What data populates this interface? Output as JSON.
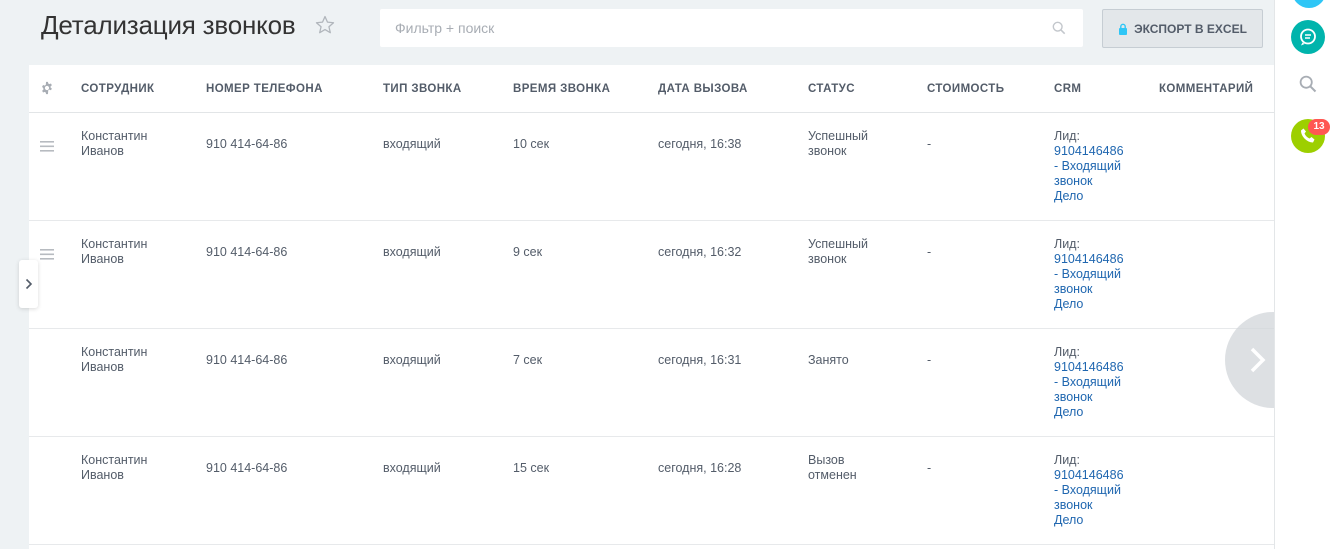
{
  "page": {
    "title": "Детализация звонков"
  },
  "search": {
    "placeholder": "Фильтр + поиск",
    "value": ""
  },
  "toolbar": {
    "export_label": "ЭКСПОРТ В EXCEL"
  },
  "table": {
    "columns": [
      "СОТРУДНИК",
      "НОМЕР ТЕЛЕФОНА",
      "ТИП ЗВОНКА",
      "ВРЕМЯ ЗВОНКА",
      "ДАТА ВЫЗОВА",
      "СТАТУС",
      "СТОИМОСТЬ",
      "CRM",
      "КОММЕНТАРИЙ"
    ],
    "rows": [
      {
        "employee_line1": "Константин",
        "employee_line2": "Иванов",
        "phone": "910 414-64-86",
        "type": "входящий",
        "duration": "10 сек",
        "date": "сегодня, 16:38",
        "status_line1": "Успешный",
        "status_line2": "звонок",
        "cost": "-",
        "crm_prefix": "Лид:",
        "crm_link1": "9104146486",
        "crm_link2": "- Входящий",
        "crm_link3": "звонок",
        "crm_link4": "Дело",
        "comment": ""
      },
      {
        "employee_line1": "Константин",
        "employee_line2": "Иванов",
        "phone": "910 414-64-86",
        "type": "входящий",
        "duration": "9 сек",
        "date": "сегодня, 16:32",
        "status_line1": "Успешный",
        "status_line2": "звонок",
        "cost": "-",
        "crm_prefix": "Лид:",
        "crm_link1": "9104146486",
        "crm_link2": "- Входящий",
        "crm_link3": "звонок",
        "crm_link4": "Дело",
        "comment": ""
      },
      {
        "employee_line1": "Константин",
        "employee_line2": "Иванов",
        "phone": "910 414-64-86",
        "type": "входящий",
        "duration": "7 сек",
        "date": "сегодня, 16:31",
        "status_line1": "Занято",
        "status_line2": "",
        "cost": "-",
        "crm_prefix": "Лид:",
        "crm_link1": "9104146486",
        "crm_link2": "- Входящий",
        "crm_link3": "звонок",
        "crm_link4": "Дело",
        "comment": ""
      },
      {
        "employee_line1": "Константин",
        "employee_line2": "Иванов",
        "phone": "910 414-64-86",
        "type": "входящий",
        "duration": "15 сек",
        "date": "сегодня, 16:28",
        "status_line1": "Вызов",
        "status_line2": "отменен",
        "cost": "-",
        "crm_prefix": "Лид:",
        "crm_link1": "9104146486",
        "crm_link2": "- Входящий",
        "crm_link3": "звонок",
        "crm_link4": "Дело",
        "comment": ""
      }
    ]
  },
  "right_panel": {
    "phone_badge": "13"
  },
  "icons": {
    "title_star": "star-outline-icon",
    "search": "search-icon",
    "export": "lock-icon",
    "settings": "gear-icon",
    "row_handle": "drag-handle-icon",
    "panel_chat": "chat-icon",
    "panel_search": "search-icon",
    "panel_phone": "phone-icon",
    "left_toggle": "chevron-right-icon",
    "scroll": "chevron-right-icon"
  },
  "colors": {
    "link": "#2067b0",
    "chat": "#00b4ac",
    "phone": "#9dcf00",
    "badge": "#ff5752",
    "top_avatar": "#2fc6f6"
  }
}
